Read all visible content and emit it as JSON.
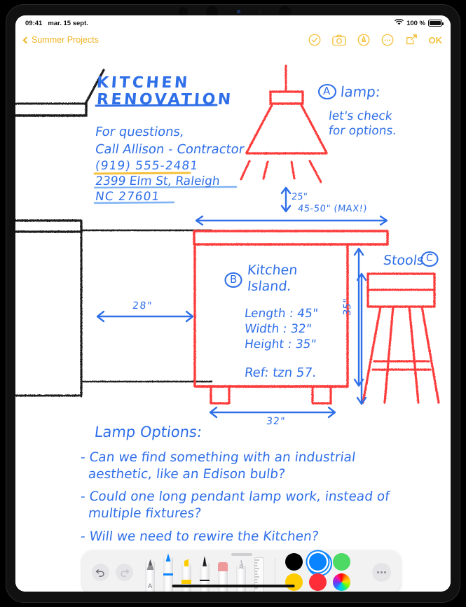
{
  "status_bar": {
    "time": "09:41",
    "date": "mar. 15 sept.",
    "wifi_icon": "wifi-icon",
    "battery_percent": "100 %",
    "battery_icon": "battery-icon"
  },
  "nav_bar": {
    "back_icon": "chevron-left-icon",
    "back_label": "Summer Projects",
    "actions": [
      {
        "name": "checkmark-circle-icon",
        "label": ""
      },
      {
        "name": "camera-icon",
        "label": ""
      },
      {
        "name": "markup-pen-circle-icon",
        "label": ""
      },
      {
        "name": "more-circle-icon",
        "label": ""
      },
      {
        "name": "compose-icon",
        "label": ""
      }
    ],
    "done_label": "OK"
  },
  "note": {
    "title_line1": "KITCHEN",
    "title_line2": "RENOVATION",
    "contact": {
      "line1": "For questions,",
      "line2": "Call Allison - Contractor",
      "phone": "(919) 555-2481",
      "address_line1": "2399 Elm St, Raleigh",
      "address_line2": "NC 27601"
    },
    "lamp": {
      "marker": "A",
      "label": "lamp:",
      "note_line1": "let's check",
      "note_line2": "for options."
    },
    "island": {
      "marker": "B",
      "label_line1": "Kitchen",
      "label_line2": "Island.",
      "specs": [
        "Length : 45\"",
        "Width : 32\"",
        "Height : 35\""
      ],
      "reference": "Ref: tzn 57."
    },
    "stools": {
      "marker": "C",
      "label": "Stools"
    },
    "dimensions": {
      "lamp_drop": "25\"",
      "lamp_span": "45-50\" (MAX!)",
      "clearance_left": "28\"",
      "island_height": "35\"",
      "island_depth": "32\""
    },
    "lamp_options": {
      "heading": "Lamp Options:",
      "items": [
        "- Can we find something with an industrial",
        "aesthetic, like an Edison bulb?",
        "- Could one long pendant lamp work, instead of",
        "multiple fixtures?",
        "- Will we need to rewire the Kitchen?"
      ]
    }
  },
  "markup_toolbar": {
    "undo_icon": "undo-icon",
    "redo_icon": "redo-icon",
    "tools": [
      {
        "name": "text-tool",
        "label": "A"
      },
      {
        "name": "pen-tool",
        "label": ""
      },
      {
        "name": "highlighter-tool",
        "label": ""
      },
      {
        "name": "marker-tool",
        "label": ""
      },
      {
        "name": "eraser-tool",
        "label": ""
      },
      {
        "name": "pencil-tool",
        "label": ""
      },
      {
        "name": "ruler-tool",
        "label": ""
      }
    ],
    "selected_tool": "pen-tool",
    "colors": [
      {
        "name": "color-black",
        "hex": "#000000",
        "selected": false
      },
      {
        "name": "color-blue",
        "hex": "#0a84ff",
        "selected": true
      },
      {
        "name": "color-green",
        "hex": "#4cd964",
        "selected": false
      },
      {
        "name": "color-yellow",
        "hex": "#ffcc00",
        "selected": false
      },
      {
        "name": "color-red",
        "hex": "#ff2d37",
        "selected": false
      },
      {
        "name": "color-wheel",
        "hex": "#ffffff",
        "selected": false
      }
    ],
    "more_icon": "more-icon"
  },
  "palette": {
    "ink_blue": "#2f6fe8",
    "ink_red": "#fc3b3b",
    "ink_black": "#1a1a1a",
    "accent_yellow": "#f5c13d"
  }
}
